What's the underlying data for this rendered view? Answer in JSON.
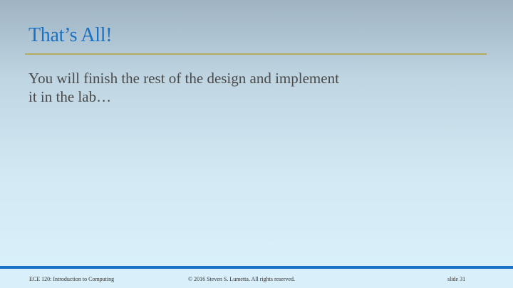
{
  "slide": {
    "title": "That’s All!",
    "body": "You will finish the rest of the design and implement it in the lab…"
  },
  "footer": {
    "course": "ECE 120: Introduction to Computing",
    "copyright": "© 2016 Steven S. Lumetta.  All rights reserved.",
    "slide_number": "slide 31"
  },
  "colors": {
    "title": "#1a72c4",
    "rule": "#b5ab5f",
    "footer_bar": "#1b73c4",
    "body_text": "#4a4a4a"
  }
}
